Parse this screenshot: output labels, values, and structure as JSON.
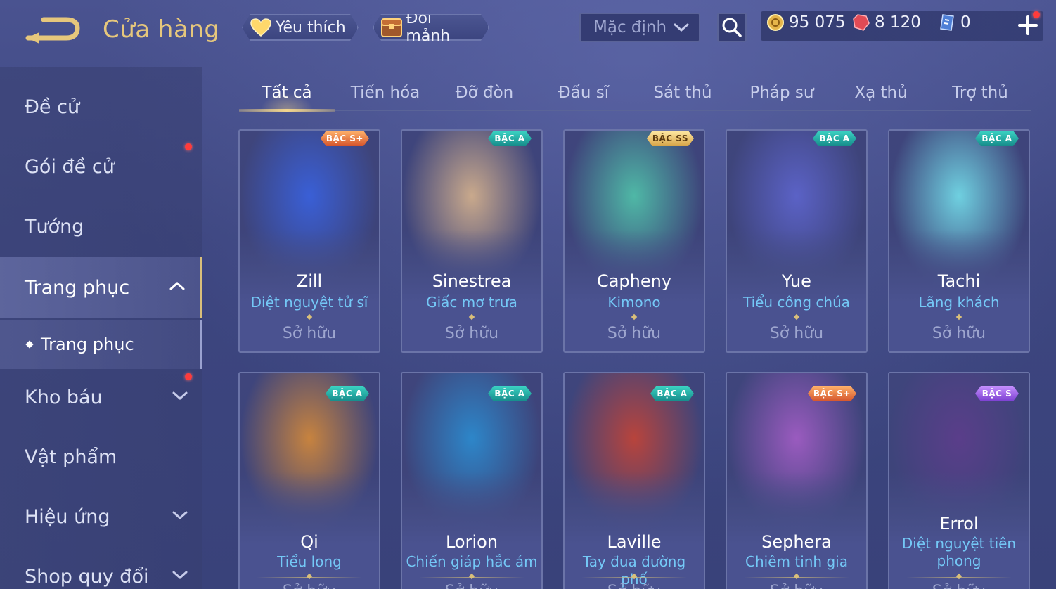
{
  "header": {
    "title": "Cửa hàng",
    "favorite_label": "Yêu thích",
    "exchange_label": "Đổi mảnh",
    "sort_value": "Mặc định"
  },
  "currency": {
    "gold": "95 075",
    "ruby": "8 120",
    "voucher": "0"
  },
  "sidebar": {
    "items": [
      {
        "label": "Đề cử"
      },
      {
        "label": "Gói đề cử",
        "dot": true
      },
      {
        "label": "Tướng"
      },
      {
        "label": "Trang phục",
        "active": true,
        "expanded": true
      },
      {
        "label": "Kho báu",
        "dot": true
      },
      {
        "label": "Vật phẩm"
      },
      {
        "label": "Hiệu ứng"
      },
      {
        "label": "Shop quy đổi"
      }
    ],
    "sub_item": "Trang phục"
  },
  "tabs": [
    {
      "label": "Tất cả",
      "active": true
    },
    {
      "label": "Tiến hóa"
    },
    {
      "label": "Đỡ đòn"
    },
    {
      "label": "Đấu sĩ"
    },
    {
      "label": "Sát thủ"
    },
    {
      "label": "Pháp sư"
    },
    {
      "label": "Xạ thủ"
    },
    {
      "label": "Trợ thủ"
    }
  ],
  "cards": [
    {
      "hero": "Zill",
      "skin": "Diệt nguyệt tử sĩ",
      "tier": "BẬC S+",
      "status": "Sở hữu",
      "accent": "#3a5fd6"
    },
    {
      "hero": "Sinestrea",
      "skin": "Giấc mơ trưa",
      "tier": "BẬC A",
      "status": "Sở hữu",
      "accent": "#c9a98c"
    },
    {
      "hero": "Capheny",
      "skin": "Kimono",
      "tier": "BẬC SS",
      "status": "Sở hữu",
      "accent": "#4fb8a6"
    },
    {
      "hero": "Yue",
      "skin": "Tiểu công chúa",
      "tier": "BẬC A",
      "status": "Sở hữu",
      "accent": "#5b62c6"
    },
    {
      "hero": "Tachi",
      "skin": "Lãng khách",
      "tier": "BẬC A",
      "status": "Sở hữu",
      "accent": "#6fd0e0"
    },
    {
      "hero": "Qi",
      "skin": "Tiểu long",
      "tier": "BẬC A",
      "status": "Sở hữu",
      "accent": "#c7833f"
    },
    {
      "hero": "Lorion",
      "skin": "Chiến giáp hắc ám",
      "tier": "BẬC A",
      "status": "Sở hữu",
      "accent": "#2d86c9"
    },
    {
      "hero": "Laville",
      "skin": "Tay đua đường phố",
      "tier": "BẬC A",
      "status": "Sở hữu",
      "accent": "#b8443c"
    },
    {
      "hero": "Sephera",
      "skin": "Chiêm tinh gia",
      "tier": "BẬC S+",
      "status": "Sở hữu",
      "accent": "#9a5bbf"
    },
    {
      "hero": "Errol",
      "skin": "Diệt nguyệt tiên phong",
      "tier": "BẬC S",
      "status": "Sở hữu",
      "accent": "#5a3e8a"
    }
  ],
  "icons": {
    "back": "back-arrow-icon",
    "heart": "heart-icon",
    "chest": "chest-icon",
    "search": "search-icon",
    "gold": "gold-coin-icon",
    "ruby": "ruby-gem-icon",
    "voucher": "voucher-icon",
    "plus": "plus-icon"
  }
}
